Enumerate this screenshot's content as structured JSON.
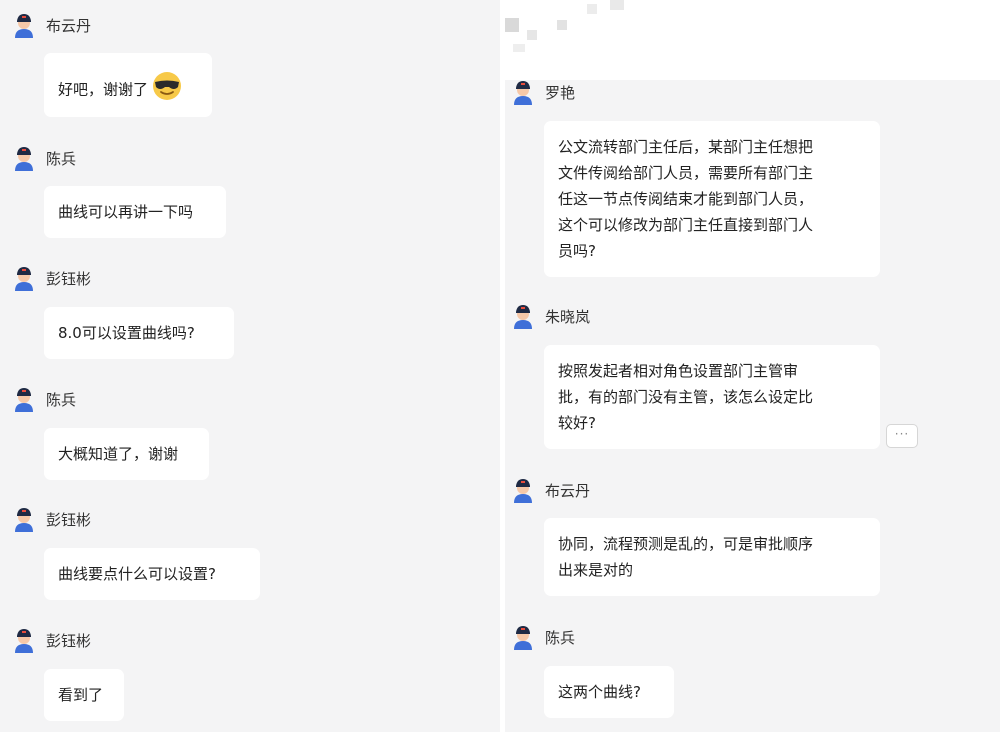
{
  "left_messages": [
    {
      "sender": "布云丹",
      "text": "好吧，谢谢了",
      "emoji": "sunglasses-emoji"
    },
    {
      "sender": "陈兵",
      "text": "曲线可以再讲一下吗"
    },
    {
      "sender": "彭钰彬",
      "text": "8.0可以设置曲线吗?"
    },
    {
      "sender": "陈兵",
      "text": "大概知道了，谢谢"
    },
    {
      "sender": "彭钰彬",
      "text": "曲线要点什么可以设置?"
    },
    {
      "sender": "彭钰彬",
      "text": "看到了"
    }
  ],
  "right_messages": [
    {
      "sender": "罗艳",
      "lines": [
        "公文流转部门主任后，某部门主任想把",
        "文件传阅给部门人员，需要所有部门主",
        "任这一节点传阅结束才能到部门人员，",
        "这个可以修改为部门主任直接到部门人",
        "员吗?"
      ]
    },
    {
      "sender": "朱晓岚",
      "lines": [
        "按照发起者相对角色设置部门主管审",
        "批，有的部门没有主管，该怎么设定比",
        "较好?"
      ],
      "more": "···"
    },
    {
      "sender": "布云丹",
      "lines": [
        "协同，流程预测是乱的，可是审批顺序",
        "出来是对的"
      ]
    },
    {
      "sender": "陈兵",
      "lines": [
        "这两个曲线?"
      ]
    }
  ],
  "colors": {
    "background": "#f4f4f5",
    "bubble": "#ffffff",
    "avatar_cap": "#1f2a44",
    "avatar_face": "#f6c8a8",
    "avatar_body": "#3f6fd8"
  }
}
